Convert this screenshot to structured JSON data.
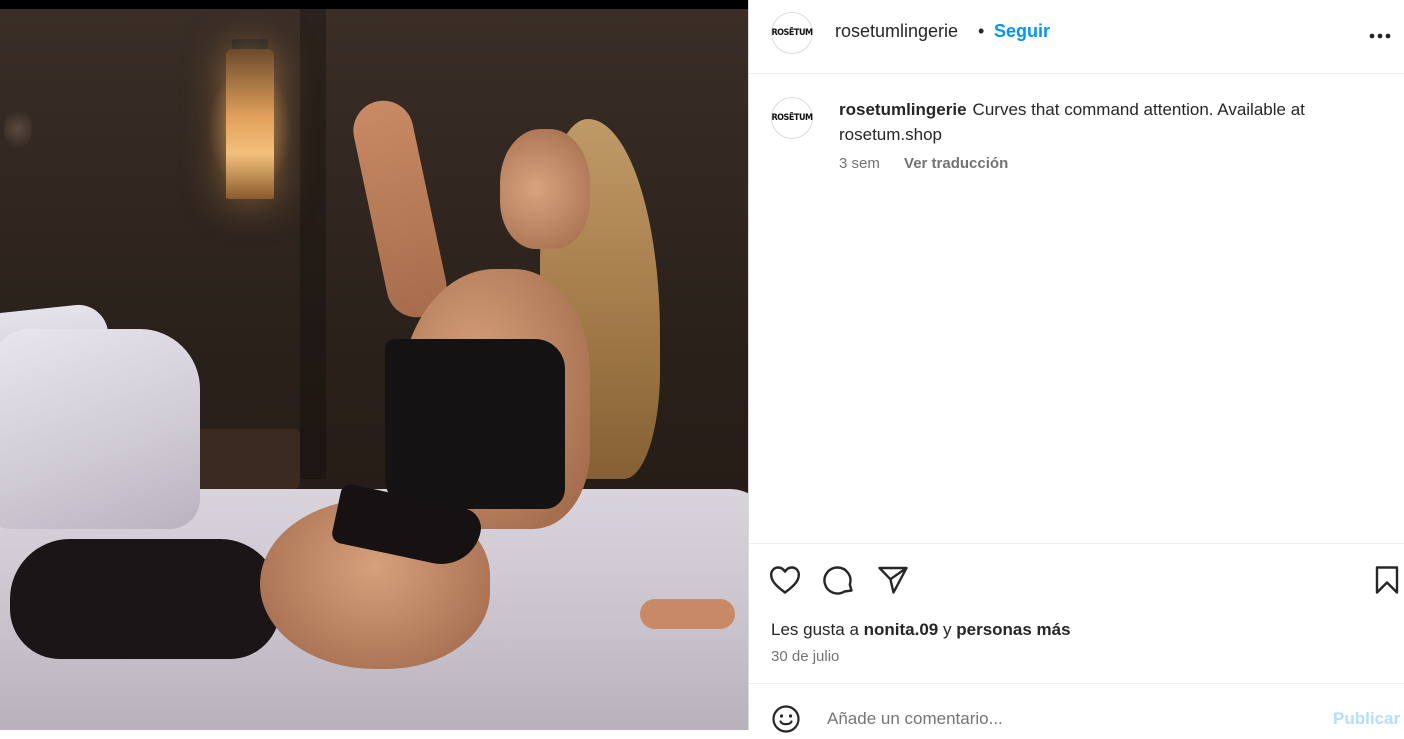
{
  "post": {
    "media_alt": "Photo post",
    "author": {
      "avatar_text": "ROSĒTUM",
      "username": "rosetumlingerie",
      "separator": "•",
      "follow_label": "Seguir",
      "more_icon": "more-horizontal-icon"
    },
    "caption": {
      "username": "rosetumlingerie",
      "text": "Curves that command attention. Available at rosetum.shop",
      "time": "3 sem",
      "translate_label": "Ver traducción"
    },
    "actions": {
      "like_icon": "heart-icon",
      "comment_icon": "comment-icon",
      "share_icon": "send-icon",
      "save_icon": "bookmark-icon"
    },
    "likes": {
      "prefix": "Les gusta a",
      "user": "nonita.09",
      "connector": "y",
      "others": "personas más"
    },
    "date": "30 de julio",
    "comment_box": {
      "emoji_icon": "smiley-icon",
      "placeholder": "Añade un comentario...",
      "publish_label": "Publicar",
      "publish_color": "#b2dffc"
    }
  },
  "colors": {
    "accent": "#0095f6",
    "muted": "#737373",
    "border": "#dbdbdb"
  }
}
